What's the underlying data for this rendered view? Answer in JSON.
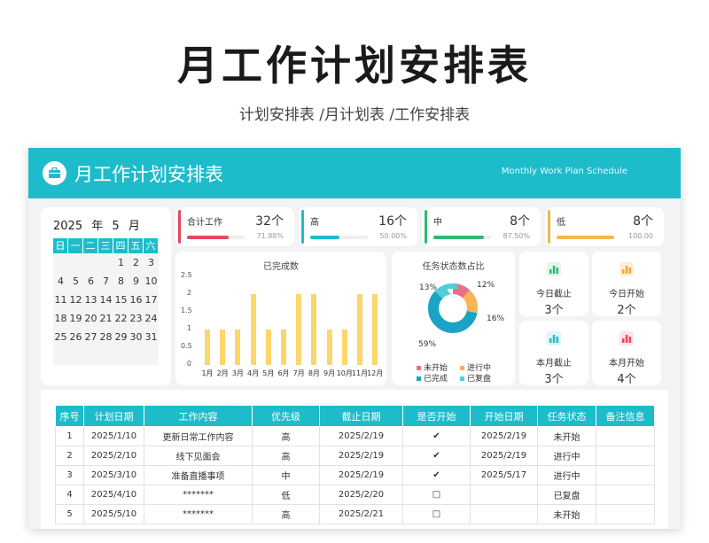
{
  "page": {
    "title": "月工作计划安排表",
    "subtitle": "计划安排表 /月计划表 /工作安排表"
  },
  "banner": {
    "title": "月工作计划安排表",
    "english": "Monthly Work Plan Schedule",
    "accent": "#1ebccb"
  },
  "calendar": {
    "year": "2025",
    "year_unit": "年",
    "month": "5",
    "month_unit": "月",
    "weekdays": [
      "日",
      "一",
      "二",
      "三",
      "四",
      "五",
      "六"
    ],
    "days": [
      "",
      "",
      "",
      "",
      "1",
      "2",
      "3",
      "4",
      "5",
      "6",
      "7",
      "8",
      "9",
      "10",
      "11",
      "12",
      "13",
      "14",
      "15",
      "16",
      "17",
      "18",
      "19",
      "20",
      "21",
      "22",
      "23",
      "24",
      "25",
      "26",
      "27",
      "28",
      "29",
      "30",
      "31",
      "",
      ""
    ]
  },
  "stats": [
    {
      "label": "合计工作",
      "count": "32个",
      "pct_text": "71.88%",
      "fill": 0.7188,
      "color": "#e8475d"
    },
    {
      "label": "高",
      "count": "16个",
      "pct_text": "50.00%",
      "fill": 0.5,
      "color": "#1ebccb"
    },
    {
      "label": "中",
      "count": "8个",
      "pct_text": "87.50%",
      "fill": 0.875,
      "color": "#2dbb6e"
    },
    {
      "label": "低",
      "count": "8个",
      "pct_text": "100.00",
      "fill": 1.0,
      "color": "#f0b94a"
    }
  ],
  "chart_data": [
    {
      "type": "bar",
      "title": "已完成数",
      "categories": [
        "1月",
        "2月",
        "3月",
        "4月",
        "5月",
        "6月",
        "7月",
        "8月",
        "9月",
        "10月",
        "11月",
        "12月"
      ],
      "values": [
        1,
        1,
        1,
        2,
        1,
        1,
        2,
        2,
        1,
        1,
        2,
        2
      ],
      "ylim": [
        0,
        2.5
      ],
      "yticks": [
        "0",
        "0.5",
        "1",
        "1.5",
        "2",
        "2.5"
      ],
      "color": "#fbd66a"
    },
    {
      "type": "pie",
      "title": "任务状态数占比",
      "labels": [
        "未开始",
        "进行中",
        "已完成",
        "已复盘"
      ],
      "values": [
        12,
        16,
        59,
        13
      ],
      "value_labels": [
        "12%",
        "16%",
        "59%",
        "13%"
      ],
      "colors": [
        "#e8718a",
        "#f6b455",
        "#1aa3c4",
        "#4fcfdb"
      ]
    }
  ],
  "summary_cards": [
    {
      "label": "今日截止",
      "value": "3个",
      "icon": "bar-chart-icon",
      "color": "#2dbb6e",
      "bg": "#e3f6ec"
    },
    {
      "label": "今日开始",
      "value": "2个",
      "icon": "stack-icon",
      "color": "#f0a63a",
      "bg": "#fdf0da"
    },
    {
      "label": "本月截止",
      "value": "3个",
      "icon": "bar-chart-icon",
      "color": "#1ebccb",
      "bg": "#dff5f8"
    },
    {
      "label": "本月开始",
      "value": "4个",
      "icon": "bar-chart-icon",
      "color": "#e8475d",
      "bg": "#fde3e7"
    }
  ],
  "table": {
    "headers": [
      "序号",
      "计划日期",
      "工作内容",
      "优先级",
      "截止日期",
      "是否开始",
      "开始日期",
      "任务状态",
      "备注信息"
    ],
    "rows": [
      [
        "1",
        "2025/1/10",
        "更新日常工作内容",
        "高",
        "2025/2/19",
        "✔",
        "2025/2/19",
        "未开始",
        ""
      ],
      [
        "2",
        "2025/2/10",
        "线下见面会",
        "高",
        "2025/2/19",
        "✔",
        "2025/2/19",
        "进行中",
        ""
      ],
      [
        "3",
        "2025/3/10",
        "准备直播事项",
        "中",
        "2025/2/19",
        "✔",
        "2025/5/17",
        "进行中",
        ""
      ],
      [
        "4",
        "2025/4/10",
        "*******",
        "低",
        "2025/2/20",
        "□",
        "",
        "已复盘",
        ""
      ],
      [
        "5",
        "2025/5/10",
        "*******",
        "高",
        "2025/2/21",
        "□",
        "",
        "未开始",
        ""
      ]
    ]
  }
}
